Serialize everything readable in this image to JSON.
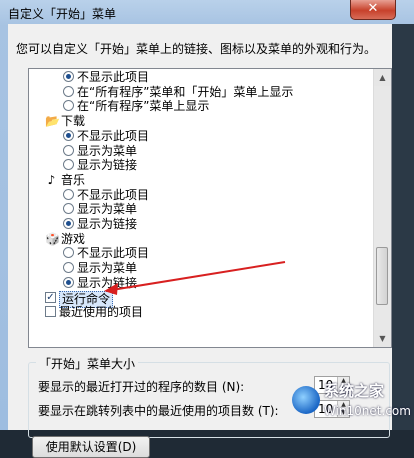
{
  "window": {
    "title": "自定义「开始」菜单",
    "close_glyph": "✕"
  },
  "description": "您可以自定义「开始」菜单上的链接、图标以及菜单的外观和行为。",
  "list": {
    "rows": [
      {
        "kind": "radio",
        "checked": true,
        "label": "不显示此项目"
      },
      {
        "kind": "radio",
        "checked": false,
        "label": "在“所有程序”菜单和「开始」菜单上显示"
      },
      {
        "kind": "radio",
        "checked": false,
        "label": "在“所有程序”菜单上显示"
      },
      {
        "kind": "header",
        "icon": "download-folder-icon",
        "label": "下载"
      },
      {
        "kind": "radio",
        "checked": true,
        "label": "不显示此项目"
      },
      {
        "kind": "radio",
        "checked": false,
        "label": "显示为菜单"
      },
      {
        "kind": "radio",
        "checked": false,
        "label": "显示为链接"
      },
      {
        "kind": "header",
        "icon": "music-note-icon",
        "label": "音乐"
      },
      {
        "kind": "radio",
        "checked": false,
        "label": "不显示此项目"
      },
      {
        "kind": "radio",
        "checked": false,
        "label": "显示为菜单"
      },
      {
        "kind": "radio",
        "checked": true,
        "label": "显示为链接"
      },
      {
        "kind": "header",
        "icon": "games-icon",
        "label": "游戏"
      },
      {
        "kind": "radio",
        "checked": false,
        "label": "不显示此项目"
      },
      {
        "kind": "radio",
        "checked": false,
        "label": "显示为菜单"
      },
      {
        "kind": "radio",
        "checked": true,
        "label": "显示为链接"
      },
      {
        "kind": "check",
        "checked": true,
        "selected": true,
        "label": "运行命令"
      },
      {
        "kind": "check",
        "checked": false,
        "label": "最近使用的项目"
      }
    ]
  },
  "start_menu_size": {
    "group_label": "「开始」菜单大小",
    "recent_programs_label": "要显示的最近打开过的程序的数目",
    "recent_programs_key": "(N):",
    "recent_programs_value": "10",
    "jumplist_label": "要显示在跳转列表中的最近使用的项目数",
    "jumplist_key": "(T):",
    "jumplist_value": "10"
  },
  "buttons": {
    "use_defaults": "使用默认设置(D)"
  },
  "watermark": {
    "line1": "系统之家",
    "line2": "Win10net.com"
  },
  "colors": {
    "arrow": "#d82020",
    "selection": "#d7e7fb"
  }
}
